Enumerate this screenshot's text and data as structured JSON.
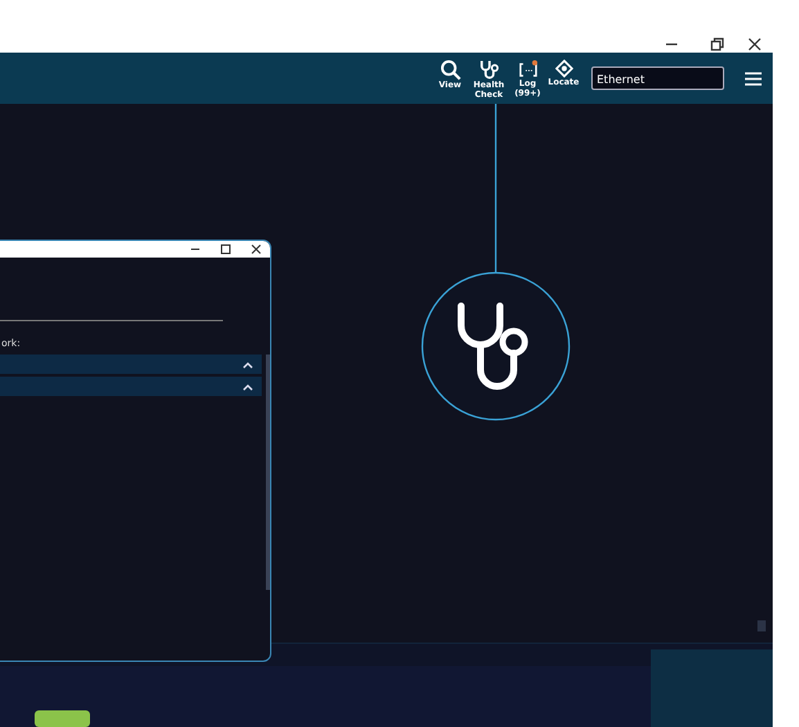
{
  "toolbar": {
    "items": [
      {
        "kind": "search",
        "label": "View"
      },
      {
        "kind": "stethoscope",
        "label": "Health Check"
      },
      {
        "kind": "log",
        "label": "Log",
        "count": "(99+)"
      },
      {
        "kind": "locate",
        "label": "Locate"
      }
    ],
    "search": {
      "value": "Ethernet"
    }
  },
  "dialog": {
    "label": "ork:",
    "sections": [
      {
        "expanded": true
      },
      {
        "expanded": true
      }
    ]
  }
}
